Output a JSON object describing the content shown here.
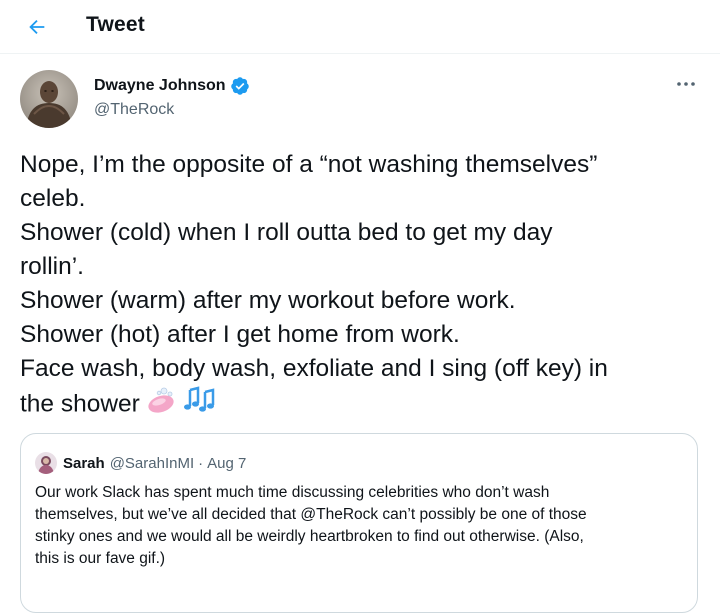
{
  "header": {
    "title": "Tweet",
    "back_icon": "arrow-left-icon"
  },
  "tweet": {
    "author_name": "Dwayne Johnson",
    "author_handle": "@TheRock",
    "verified": true,
    "more_icon": "more-dots-icon",
    "text_lines": [
      "Nope, I’m the opposite of a “not washing themselves”",
      "celeb.",
      "Shower (cold) when I roll outta bed to get my day",
      "rollin’.",
      "Shower (warm) after my workout before work.",
      "Shower (hot) after I get home from work.",
      "Face wash, body wash, exfoliate and I sing (off key) in",
      "the shower"
    ],
    "emojis": [
      "soap-emoji",
      "musical-notes-emoji"
    ]
  },
  "quote": {
    "author_name": "Sarah",
    "author_handle": "@SarahInMI",
    "separator": "·",
    "date": "Aug 7",
    "text_lines": [
      "Our work Slack has spent much time discussing celebrities who don’t wash",
      "themselves, but we’ve all decided that @TheRock can’t possibly be one of those",
      "stinky ones and we would all be weirdly heartbroken to find out otherwise. (Also,",
      "this is our fave gif.)"
    ]
  },
  "colors": {
    "accent": "#1d9bf0",
    "text_primary": "#0f1419",
    "text_secondary": "#536471",
    "border": "#cfd9de",
    "soap": "#f4a6c8",
    "music_notes": "#3a9be8"
  }
}
